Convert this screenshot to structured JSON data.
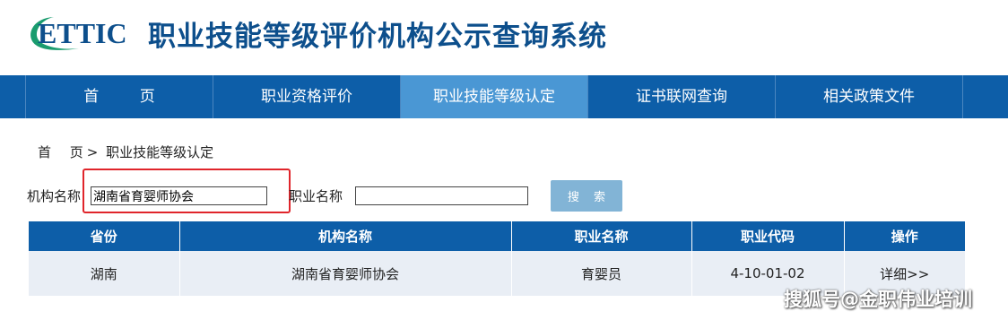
{
  "header": {
    "logo_text": "ETTIC",
    "site_title": "职业技能等级评价机构公示查询系统"
  },
  "nav": {
    "items": [
      {
        "label": "首 页"
      },
      {
        "label": "职业资格评价"
      },
      {
        "label": "职业技能等级认定"
      },
      {
        "label": "证书联网查询"
      },
      {
        "label": "相关政策文件"
      }
    ],
    "active_index": 2
  },
  "breadcrumb": {
    "home": "首 页",
    "separator": ">",
    "current": "职业技能等级认定"
  },
  "search": {
    "org_label": "机构名称",
    "org_value": "湖南省育婴师协会",
    "job_label": "职业名称",
    "job_value": "",
    "button_label": "搜 索"
  },
  "table": {
    "headers": [
      "省份",
      "机构名称",
      "职业名称",
      "职业代码",
      "操作"
    ],
    "rows": [
      {
        "province": "湖南",
        "org": "湖南省育婴师协会",
        "job": "育婴员",
        "code": "4-10-01-02",
        "action": "详细>>"
      }
    ]
  },
  "watermark": "搜狐号@金职伟业培训",
  "colors": {
    "nav_bg": "#0d5ea8",
    "nav_active": "#4a97d4",
    "title": "#0d4f8c",
    "logo_green": "#1a9c6e",
    "highlight": "#e0252b",
    "row_bg": "#e9eef5",
    "button_bg": "#82b4d6"
  }
}
